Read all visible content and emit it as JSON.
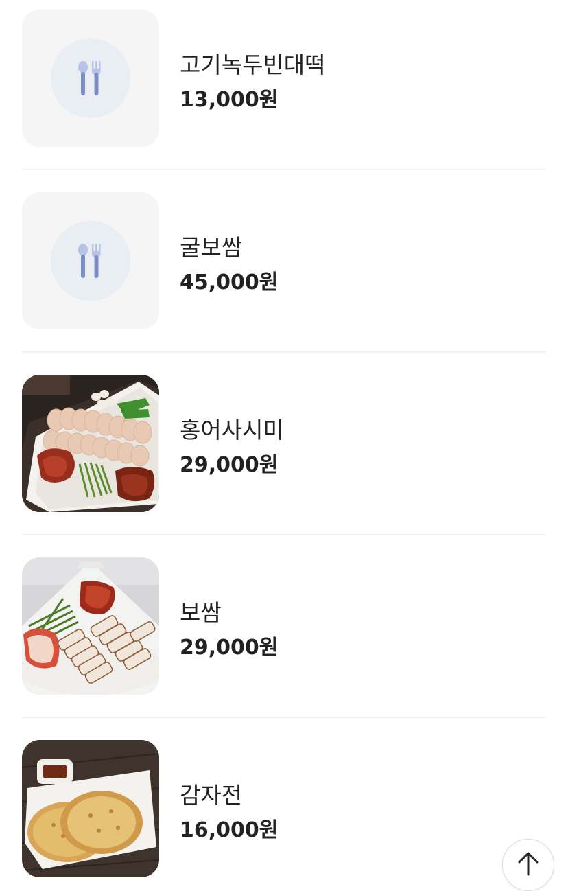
{
  "menu": {
    "items": [
      {
        "name": "고기녹두빈대떡",
        "price": "13,000원",
        "image": "placeholder-utensils-icon"
      },
      {
        "name": "굴보쌈",
        "price": "45,000원",
        "image": "placeholder-utensils-icon"
      },
      {
        "name": "홍어사시미",
        "price": "29,000원",
        "image": "photo-hongeo-sashimi"
      },
      {
        "name": "보쌈",
        "price": "29,000원",
        "image": "photo-bossam"
      },
      {
        "name": "감자전",
        "price": "16,000원",
        "image": "photo-gamjajeon"
      }
    ]
  },
  "controls": {
    "scroll_top_icon": "arrow-up-icon"
  },
  "colors": {
    "text": "#222222",
    "placeholder_bg": "#f5f5f6",
    "placeholder_circle": "#e9edf4",
    "utensil_icon": "#7b8ec4",
    "divider": "#f1f1f2"
  }
}
